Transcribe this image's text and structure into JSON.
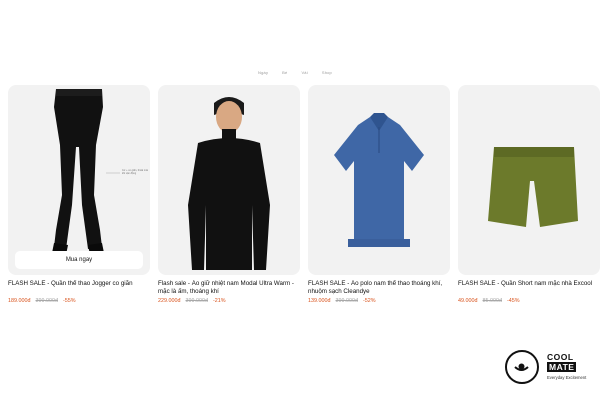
{
  "nav": [
    "Ngày",
    "Bé",
    "Vải",
    "Shop"
  ],
  "buy_button": "Mua ngay",
  "annotation": "Cơ + co giãn, thoải mái khi vận động",
  "products": [
    {
      "name": "FLASH SALE - Quần thể thao Jogger co giãn",
      "price": "189.000đ",
      "old_price": "399.000đ",
      "discount": "-55%",
      "image": "black-jogger-pants"
    },
    {
      "name": "Flash sale - Áo giữ nhiệt nam Modal Ultra Warm - mặc là ấm, thoáng khí",
      "price": "229.000đ",
      "old_price": "399.000đ",
      "discount": "-21%",
      "image": "black-turtleneck-model"
    },
    {
      "name": "FLASH SALE - Áo polo nam thể thao thoáng khí, nhuộm sạch Cleandye",
      "price": "139.000đ",
      "old_price": "399.000đ",
      "discount": "-52%",
      "image": "blue-polo-shirt"
    },
    {
      "name": "FLASH SALE - Quần Short nam mặc nhà Excool",
      "price": "49.000đ",
      "old_price": "85.000đ",
      "discount": "-45%",
      "image": "olive-shorts"
    }
  ],
  "logo": {
    "line1": "COOL",
    "line2": "MATE",
    "tagline": "Everyday Excitement"
  },
  "colors": {
    "accent": "#d9541e",
    "card_bg": "#f2f2f2"
  }
}
